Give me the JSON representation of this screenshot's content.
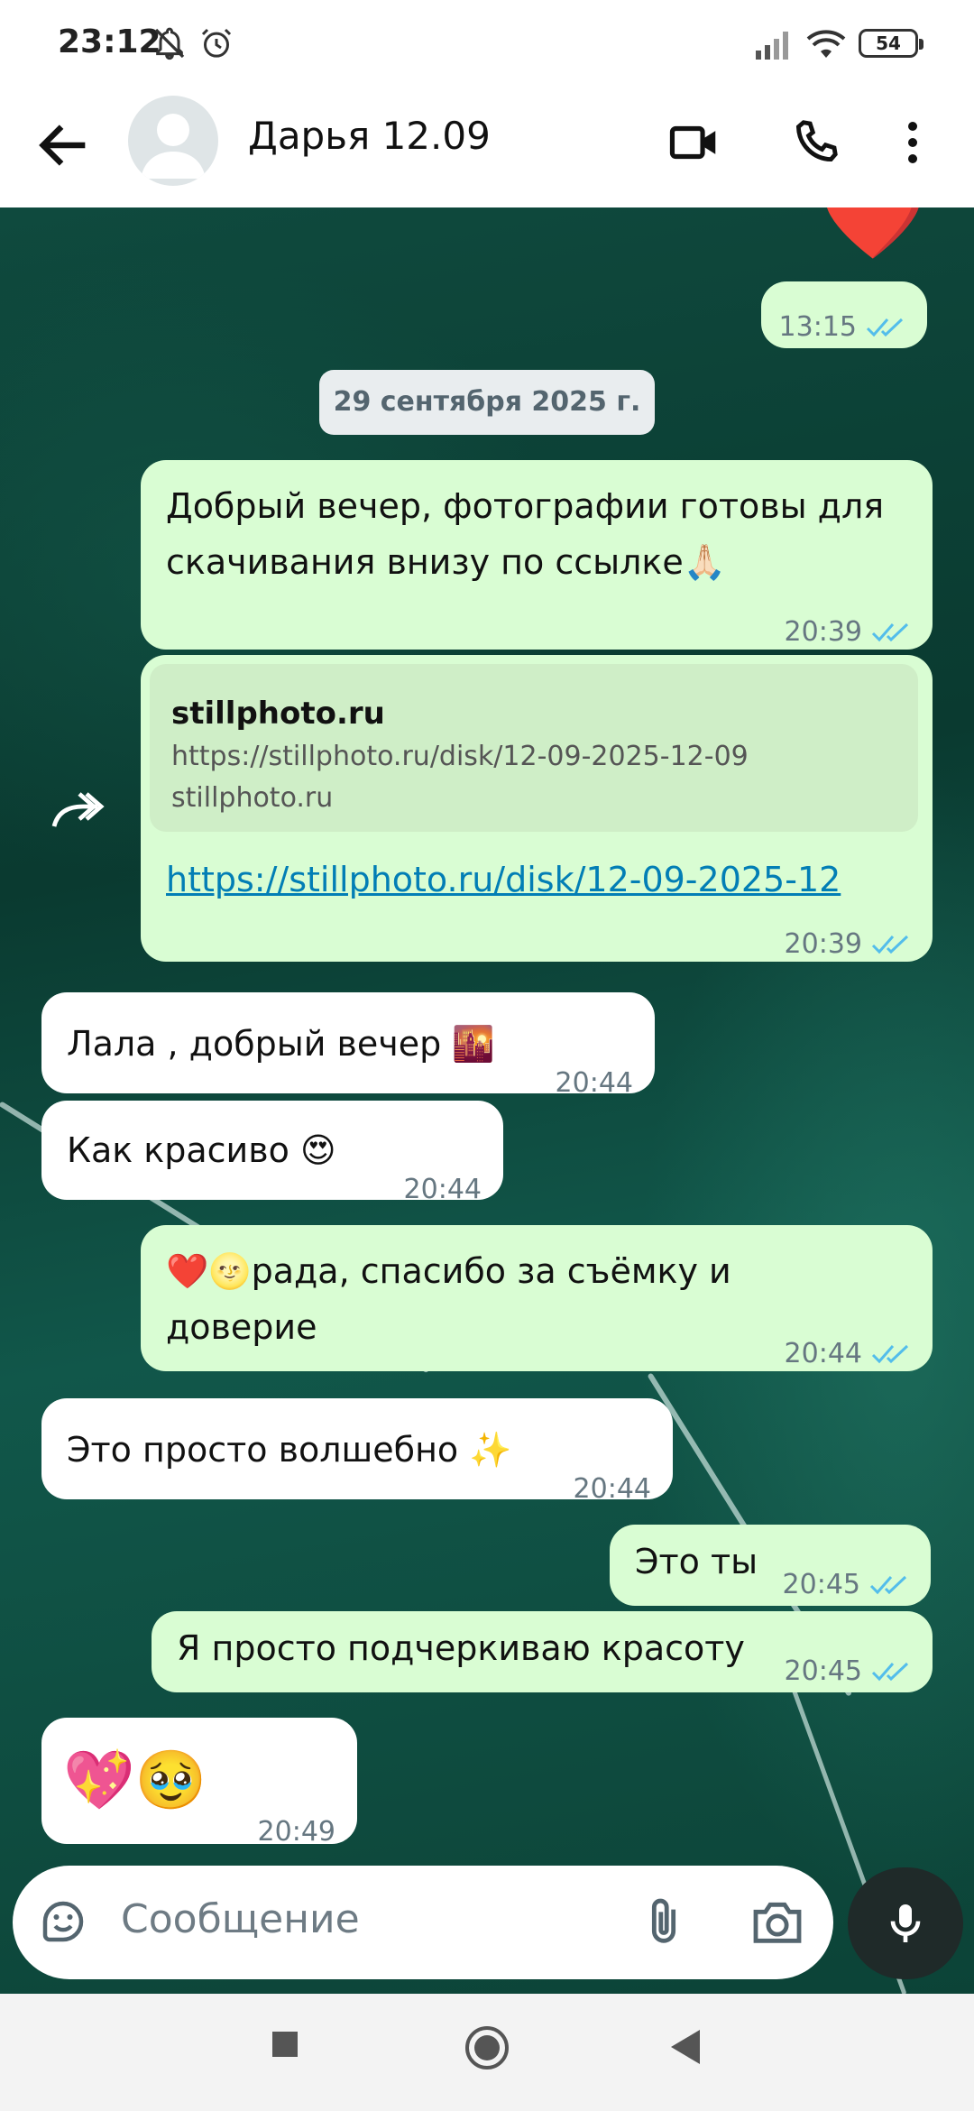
{
  "status_bar": {
    "time": "23:12",
    "icons": [
      "bell-off-icon",
      "alarm-icon",
      "signal-icon",
      "wifi-icon"
    ],
    "battery": "54"
  },
  "header": {
    "contact_name": "Дарья 12.09",
    "icons": [
      "back-arrow-icon",
      "avatar",
      "video-call-icon",
      "phone-icon",
      "more-vert-icon"
    ]
  },
  "chat": {
    "date_separator": "29 сентября 2025 г.",
    "messages": [
      {
        "dir": "out",
        "text": "",
        "time": "13:15",
        "reaction": "❤️"
      },
      {
        "dir": "out",
        "text": "Добрый вечер, фотографии готовы для скачивания внизу по ссылке🙏🏻",
        "time": "20:39"
      },
      {
        "dir": "out",
        "preview_title": "stillphoto.ru",
        "preview_desc": "https://stillphoto.ru/disk/12-09-2025-12-09",
        "preview_domain": "stillphoto.ru",
        "text": "https://stillphoto.ru/disk/12-09-2025-12",
        "time": "20:39"
      },
      {
        "dir": "in",
        "text": "Лала , добрый вечер 🌇",
        "time": "20:44"
      },
      {
        "dir": "in",
        "text": "Как красиво 😍",
        "time": "20:44"
      },
      {
        "dir": "out",
        "text": "❤️🌝рада, спасибо за съёмку и доверие",
        "time": "20:44"
      },
      {
        "dir": "in",
        "text": "Это просто волшебно ✨",
        "time": "20:44"
      },
      {
        "dir": "out",
        "text": "Это ты",
        "time": "20:45"
      },
      {
        "dir": "out",
        "text": "Я просто подчеркиваю красоту",
        "time": "20:45"
      },
      {
        "dir": "in",
        "text": "💖🥹",
        "time": "20:49"
      }
    ]
  },
  "composer": {
    "placeholder": "Сообщение",
    "icons": [
      "sticker-icon",
      "attach-icon",
      "camera-icon",
      "mic-icon"
    ]
  },
  "nav": {
    "icons": [
      "recents-icon",
      "home-icon",
      "back-icon"
    ]
  },
  "colors": {
    "outgoing": "#d9fdd3",
    "incoming": "#ffffff",
    "ticks": "#53bdeb",
    "link": "#027eb5"
  }
}
